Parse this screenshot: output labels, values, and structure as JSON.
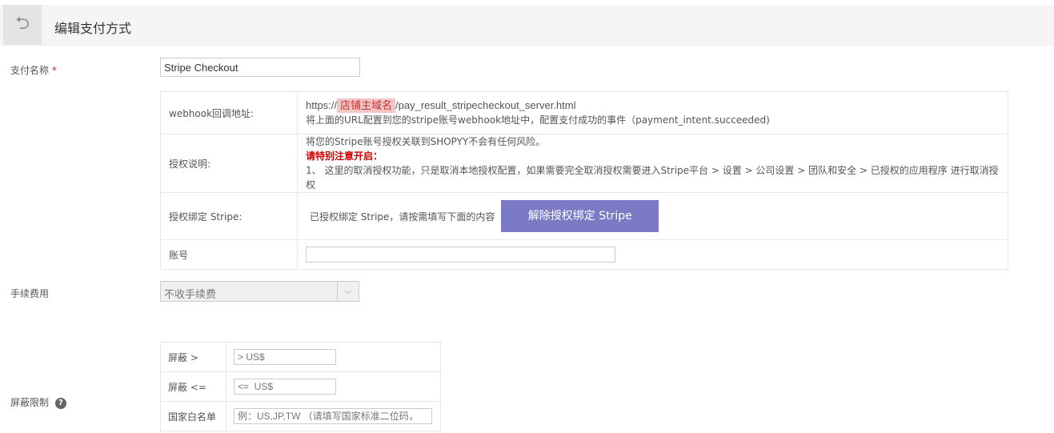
{
  "header": {
    "title": "编辑支付方式",
    "back_icon": "undo-arrow-icon"
  },
  "form": {
    "payment_name": {
      "label": "支付名称",
      "required_mark": "*",
      "value": "Stripe Checkout"
    },
    "config": {
      "webhook": {
        "label": "webhook回调地址:",
        "url_prefix": "https://",
        "url_mask": "店铺主域名",
        "url_suffix": "/pay_result_stripecheckout_server.html",
        "hint": "将上面的URL配置到您的stripe账号webhook地址中，配置支付成功的事件（payment_intent.succeeded)"
      },
      "auth_desc": {
        "label": "授权说明:",
        "line1": "将您的Stripe账号授权关联到SHOPYY不会有任何风险。",
        "warning": "请特别注意开启",
        "warning_colon": "：",
        "line3": "1、 这里的取消授权功能，只是取消本地授权配置，如果需要完全取消授权需要进入Stripe平台 > 设置 > 公司设置 > 团队和安全 > 已授权的应用程序 进行取消授权"
      },
      "bind": {
        "label": "授权绑定 Stripe:",
        "status": "已授权绑定 Stripe，请按需填写下面的内容",
        "unbind_button": "解除授权绑定 Stripe",
        "button_color": "#7b7ac4"
      },
      "account": {
        "label": "账号",
        "value": ""
      }
    },
    "fee": {
      "label": "手续费用",
      "selected": "不收手续费"
    },
    "limit": {
      "label": "屏蔽限制",
      "help_icon": "question-circle-icon",
      "rows": [
        {
          "label": "屏蔽 >",
          "placeholder": "> US$"
        },
        {
          "label": "屏蔽 <=",
          "placeholder": "<=  US$"
        },
        {
          "label": "国家白名单",
          "placeholder": "例：US,JP,TW （请填写国家标准二位码，"
        }
      ]
    }
  }
}
